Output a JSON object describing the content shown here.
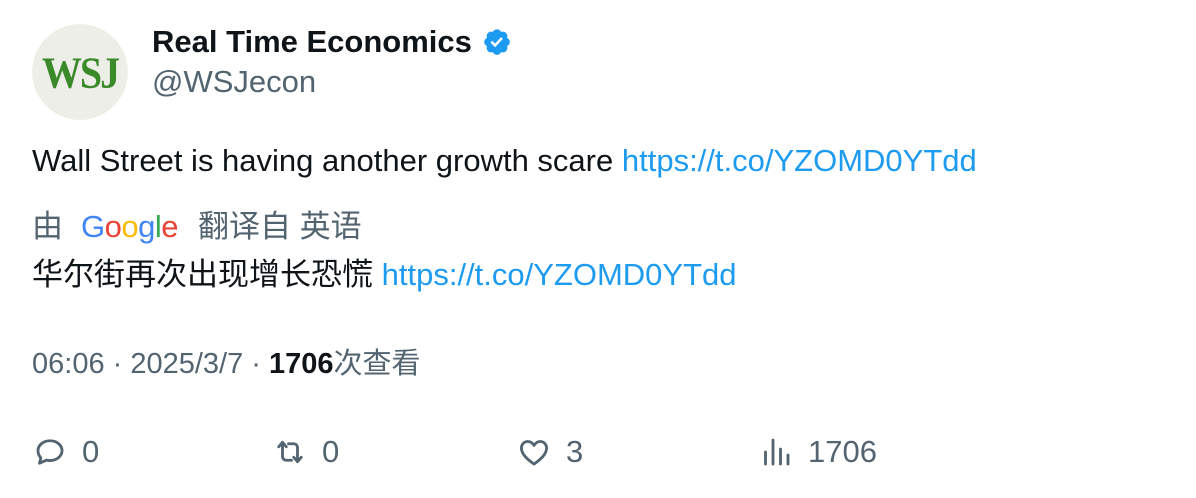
{
  "author": {
    "avatar_text": "WSJ",
    "display_name": "Real Time Economics",
    "handle": "@WSJecon",
    "verified": true
  },
  "tweet": {
    "text": "Wall Street is having another growth scare ",
    "link": "https://t.co/YZOMD0YTdd"
  },
  "translation": {
    "by_label": "由",
    "provider": "Google",
    "translated_from": "翻译自 英语",
    "text": "华尔街再次出现增长恐慌 ",
    "link": "https://t.co/YZOMD0YTdd"
  },
  "meta": {
    "time": "06:06",
    "separator": " · ",
    "date": "2025/3/7",
    "views": "1706",
    "views_label": "次查看"
  },
  "actions": {
    "reply_count": "0",
    "retweet_count": "0",
    "like_count": "3",
    "views_count": "1706"
  },
  "colors": {
    "link": "#1d9bf0",
    "secondary_text": "#536471",
    "primary_text": "#0f1419",
    "verified": "#1d9bf0"
  }
}
